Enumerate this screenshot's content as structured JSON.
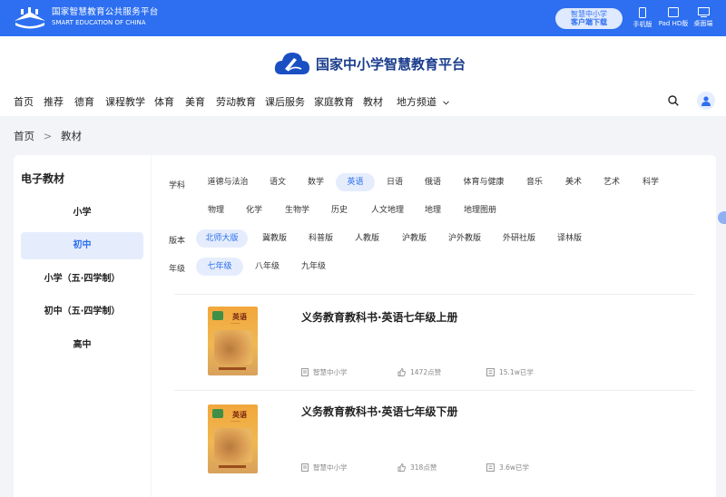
{
  "topbar": {
    "title": "国家智慧教育公共服务平台",
    "subtitle": "SMART EDUCATION OF CHINA",
    "download": {
      "line1": "智慧中小学",
      "line2": "客户端下载"
    },
    "devices": [
      {
        "label": "手机版",
        "icon": "phone-icon"
      },
      {
        "label": "Pad HD版",
        "icon": "tablet-icon"
      },
      {
        "label": "桌面端",
        "icon": "desktop-icon"
      }
    ],
    "color": "#2d6ff0"
  },
  "header": {
    "brand": "国家中小学智慧教育平台",
    "nav": [
      "首页",
      "推荐",
      "德育",
      "课程教学",
      "体育",
      "美育",
      "劳动教育",
      "课后服务",
      "家庭教育",
      "教材",
      "地方频道"
    ]
  },
  "breadcrumb": [
    "首页",
    ">",
    "教材"
  ],
  "sidebar": {
    "title": "电子教材",
    "items": [
      "小学",
      "初中",
      "小学（五·四学制）",
      "初中（五·四学制）",
      "高中"
    ],
    "active_index": 1
  },
  "filters": {
    "subject_label": "学科",
    "subjects_row1": [
      "道德与法治",
      "语文",
      "数学",
      "英语",
      "日语",
      "俄语",
      "体育与健康",
      "音乐",
      "美术",
      "艺术",
      "科学"
    ],
    "subjects_row2": [
      "物理",
      "化学",
      "生物学",
      "历史",
      "人文地理",
      "地理",
      "地理图册"
    ],
    "subject_active": "英语",
    "edition_label": "版本",
    "editions": [
      "北师大版",
      "冀教版",
      "科普版",
      "人教版",
      "沪教版",
      "沪外教版",
      "外研社版",
      "译林版"
    ],
    "edition_active": "北师大版",
    "grade_label": "年级",
    "grades": [
      "七年级",
      "八年级",
      "九年级"
    ],
    "grade_active": "七年级"
  },
  "books": [
    {
      "title": "义务教育教科书·英语七年级上册",
      "cover_title": "英语",
      "publisher": "智慧中小学",
      "likes": "1472点赞",
      "learners": "15.1w已学"
    },
    {
      "title": "义务教育教科书·英语七年级下册",
      "cover_title": "英语",
      "publisher": "智慧中小学",
      "likes": "318点赞",
      "learners": "3.6w已学"
    }
  ]
}
